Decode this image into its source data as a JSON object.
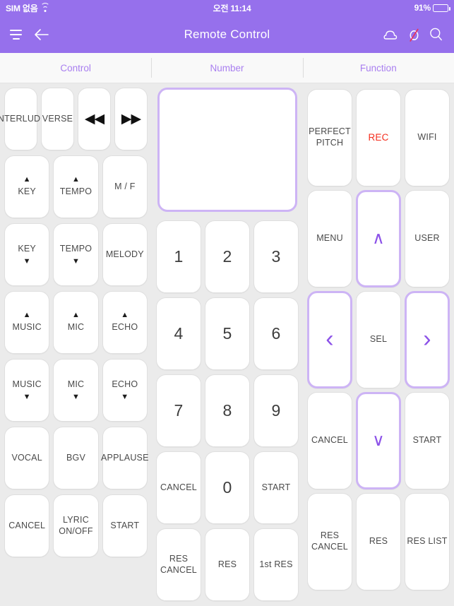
{
  "status_bar": {
    "carrier": "SIM 없음",
    "time": "오전 11:14",
    "battery_percent": "91%",
    "battery_level": 91,
    "wifi_icon": "wifi-icon",
    "battery_icon": "battery-icon"
  },
  "nav": {
    "title": "Remote Control",
    "menu_icon": "hamburger-menu-icon",
    "back_icon": "back-arrow-icon",
    "cloud_icon": "cloud-icon",
    "blocked_icon": "no-entry-slash-icon",
    "search_icon": "search-icon"
  },
  "tabs": [
    {
      "label": "Control",
      "name": "tab-control"
    },
    {
      "label": "Number",
      "name": "tab-number"
    },
    {
      "label": "Function",
      "name": "tab-function"
    }
  ],
  "colors": {
    "accent_purple": "#9670ec",
    "tab_text": "#a97ff0",
    "highlight_border": "#cdb4f5",
    "rec_red": "#f52e1e",
    "content_bg": "#ebebeb",
    "key_bg": "#ffffff"
  },
  "control_panel": {
    "rows": [
      [
        {
          "label": "INTERLUDE",
          "name": "key-interlude"
        },
        {
          "label": "VERSE",
          "name": "key-verse"
        },
        {
          "glyph": "◀◀",
          "label": "",
          "name": "key-rewind"
        },
        {
          "glyph": "▶▶",
          "label": "",
          "name": "key-fast-forward"
        }
      ],
      [
        {
          "up": "▲",
          "label": "KEY",
          "name": "key-key-up"
        },
        {
          "up": "▲",
          "label": "TEMPO",
          "name": "key-tempo-up"
        },
        {
          "label": "M / F",
          "name": "key-male-female"
        }
      ],
      [
        {
          "label": "KEY",
          "down": "▼",
          "name": "key-key-down"
        },
        {
          "label": "TEMPO",
          "down": "▼",
          "name": "key-tempo-down"
        },
        {
          "label": "MELODY",
          "name": "key-melody"
        }
      ],
      [
        {
          "up": "▲",
          "label": "MUSIC",
          "name": "key-music-up"
        },
        {
          "up": "▲",
          "label": "MIC",
          "name": "key-mic-up"
        },
        {
          "up": "▲",
          "label": "ECHO",
          "name": "key-echo-up"
        }
      ],
      [
        {
          "label": "MUSIC",
          "down": "▼",
          "name": "key-music-down"
        },
        {
          "label": "MIC",
          "down": "▼",
          "name": "key-mic-down"
        },
        {
          "label": "ECHO",
          "down": "▼",
          "name": "key-echo-down"
        }
      ],
      [
        {
          "label": "VOCAL",
          "name": "key-vocal"
        },
        {
          "label": "BGV",
          "name": "key-bgv"
        },
        {
          "label": "APPLAUSE",
          "name": "key-applause"
        }
      ],
      [
        {
          "label": "CANCEL",
          "name": "key-cancel"
        },
        {
          "label": "LYRIC\nON/OFF",
          "name": "key-lyric-onoff"
        },
        {
          "label": "START",
          "name": "key-start"
        }
      ]
    ]
  },
  "number_panel": {
    "display_value": "",
    "rows": [
      [
        {
          "num": "1",
          "name": "key-num-1"
        },
        {
          "num": "2",
          "name": "key-num-2"
        },
        {
          "num": "3",
          "name": "key-num-3"
        }
      ],
      [
        {
          "num": "4",
          "name": "key-num-4"
        },
        {
          "num": "5",
          "name": "key-num-5"
        },
        {
          "num": "6",
          "name": "key-num-6"
        }
      ],
      [
        {
          "num": "7",
          "name": "key-num-7"
        },
        {
          "num": "8",
          "name": "key-num-8"
        },
        {
          "num": "9",
          "name": "key-num-9"
        }
      ],
      [
        {
          "label": "CANCEL",
          "name": "key-num-cancel"
        },
        {
          "num": "0",
          "name": "key-num-0"
        },
        {
          "label": "START",
          "name": "key-num-start"
        }
      ],
      [
        {
          "label": "RES CANCEL",
          "name": "key-res-cancel"
        },
        {
          "label": "RES",
          "name": "key-res"
        },
        {
          "label": "1st RES",
          "name": "key-first-res"
        }
      ]
    ]
  },
  "function_panel": {
    "rows": [
      [
        {
          "label": "PERFECT\nPITCH",
          "name": "key-perfect-pitch"
        },
        {
          "label": "REC",
          "rec": true,
          "name": "key-rec"
        },
        {
          "label": "WIFI",
          "name": "key-wifi"
        }
      ],
      [
        {
          "label": "MENU",
          "name": "key-menu"
        },
        {
          "chev": "∧",
          "label": "",
          "highlight": true,
          "name": "key-nav-up"
        },
        {
          "label": "USER",
          "name": "key-user"
        }
      ],
      [
        {
          "chev": "‹",
          "label": "",
          "highlight": true,
          "name": "key-nav-left"
        },
        {
          "label": "SEL",
          "name": "key-sel"
        },
        {
          "chev": "›",
          "label": "",
          "highlight": true,
          "name": "key-nav-right"
        }
      ],
      [
        {
          "label": "CANCEL",
          "name": "key-fn-cancel"
        },
        {
          "chev": "∨",
          "label": "",
          "highlight": true,
          "name": "key-nav-down"
        },
        {
          "label": "START",
          "name": "key-fn-start"
        }
      ],
      [
        {
          "label": "RES CANCEL",
          "name": "key-fn-res-cancel"
        },
        {
          "label": "RES",
          "name": "key-fn-res"
        },
        {
          "label": "RES LIST",
          "name": "key-fn-res-list"
        }
      ]
    ]
  }
}
